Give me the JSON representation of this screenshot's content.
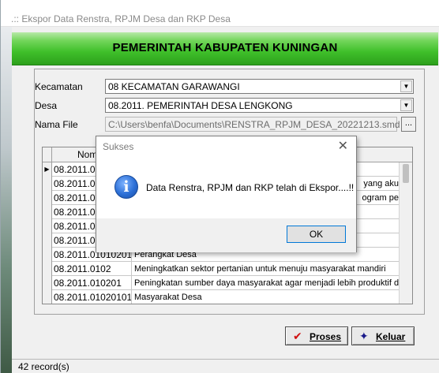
{
  "window": {
    "title": ".:: Ekspor Data Renstra, RPJM Desa dan RKP Desa"
  },
  "banner": {
    "text": "PEMERINTAH KABUPATEN KUNINGAN"
  },
  "form": {
    "kecamatan_label": "Kecamatan",
    "kecamatan_value": "08  KECAMATAN GARAWANGI",
    "desa_label": "Desa",
    "desa_value": "08.2011.  PEMERINTAH DESA LENGKONG",
    "file_label": "Nama File",
    "file_value": "C:\\Users\\benfa\\Documents\\RENSTRA_RPJM_DESA_20221213.smd",
    "browse_label": "..."
  },
  "grid": {
    "col_nomor": "Nomor",
    "rows": [
      {
        "no": "08.2011.01",
        "text": ""
      },
      {
        "no": "08.2011.01",
        "text": "yang aku"
      },
      {
        "no": "08.2011.01",
        "text": "ogram pe"
      },
      {
        "no": "08.2011.01",
        "text": ""
      },
      {
        "no": "08.2011.01",
        "text": ""
      },
      {
        "no": "08.2011.01",
        "text": ""
      },
      {
        "no": "08.2011.01010201",
        "text": "Perangkat Desa"
      },
      {
        "no": "08.2011.0102",
        "text": "Meningkatkan sektor pertanian untuk menuju masyarakat mandiri"
      },
      {
        "no": "08.2011.010201",
        "text": "Peningkatan sumber daya masyarakat agar menjadi lebih produktif da"
      },
      {
        "no": "08.2011.01020101",
        "text": "Masyarakat Desa"
      }
    ]
  },
  "buttons": {
    "proses": "Proses",
    "keluar": "Keluar"
  },
  "status": {
    "records": "42  record(s)"
  },
  "dialog": {
    "title": "Sukses",
    "message": "Data Renstra, RPJM dan RKP telah di Ekspor....!!",
    "ok": "OK"
  }
}
